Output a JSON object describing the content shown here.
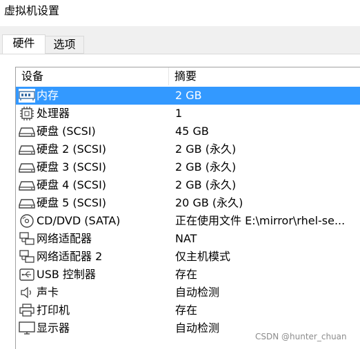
{
  "window": {
    "title": "虚拟机设置"
  },
  "tabs": [
    {
      "label": "硬件",
      "active": true
    },
    {
      "label": "选项",
      "active": false
    }
  ],
  "columns": {
    "device": "设备",
    "summary": "摘要"
  },
  "devices": [
    {
      "name": "内存",
      "summary": "2 GB",
      "icon": "memory-icon",
      "selected": true
    },
    {
      "name": "处理器",
      "summary": "1",
      "icon": "processor-icon",
      "selected": false
    },
    {
      "name": "硬盘 (SCSI)",
      "summary": "45 GB",
      "icon": "hard-disk-icon",
      "selected": false
    },
    {
      "name": "硬盘 2 (SCSI)",
      "summary": "2 GB (永久)",
      "icon": "hard-disk-icon",
      "selected": false
    },
    {
      "name": "硬盘 3 (SCSI)",
      "summary": "2 GB (永久)",
      "icon": "hard-disk-icon",
      "selected": false
    },
    {
      "name": "硬盘 4 (SCSI)",
      "summary": "2 GB (永久)",
      "icon": "hard-disk-icon",
      "selected": false
    },
    {
      "name": "硬盘 5 (SCSI)",
      "summary": "20 GB (永久)",
      "icon": "hard-disk-icon",
      "selected": false
    },
    {
      "name": "CD/DVD (SATA)",
      "summary": "正在使用文件 E:\\mirror\\rhel-se...",
      "icon": "cd-dvd-icon",
      "selected": false
    },
    {
      "name": "网络适配器",
      "summary": "NAT",
      "icon": "network-adapter-icon",
      "selected": false
    },
    {
      "name": "网络适配器 2",
      "summary": "仅主机模式",
      "icon": "network-adapter-icon",
      "selected": false
    },
    {
      "name": "USB 控制器",
      "summary": "存在",
      "icon": "usb-icon",
      "selected": false
    },
    {
      "name": "声卡",
      "summary": "自动检测",
      "icon": "speaker-icon",
      "selected": false
    },
    {
      "name": "打印机",
      "summary": "存在",
      "icon": "printer-icon",
      "selected": false
    },
    {
      "name": "显示器",
      "summary": "自动检测",
      "icon": "monitor-icon",
      "selected": false
    }
  ],
  "watermark": "CSDN @hunter_chuan",
  "colors": {
    "selection": "#3399ff",
    "selection_text": "#ffffff"
  }
}
